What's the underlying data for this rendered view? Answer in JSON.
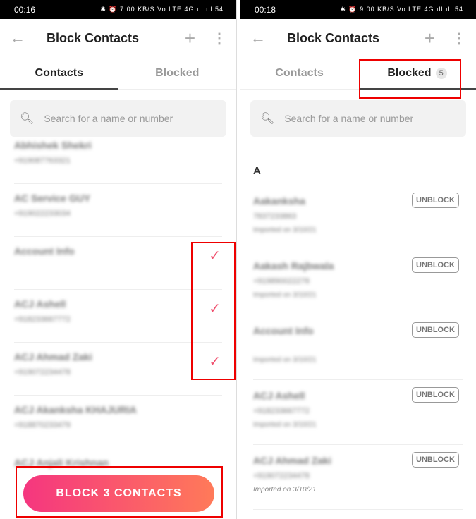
{
  "left": {
    "status": {
      "time": "00:16",
      "icons": "✱ ⏰ 7.00 KB/S Vo LTE 4G ıll ıll 54"
    },
    "title": "Block Contacts",
    "tabs": [
      "Contacts",
      "Blocked"
    ],
    "search_placeholder": "Search for a name or number",
    "contacts": [
      {
        "name": "Abhishek Shekri",
        "phone": "+919087763321",
        "checked": false
      },
      {
        "name": "AC Service GUY",
        "phone": "+919022233034",
        "checked": false
      },
      {
        "name": "Account Info",
        "phone": "",
        "checked": true
      },
      {
        "name": "ACJ Ashell",
        "phone": "+918233667772",
        "checked": true
      },
      {
        "name": "ACJ Ahmad Zaki",
        "phone": "+919072234478",
        "checked": true
      },
      {
        "name": "ACJ Akanksha KHAJURIA",
        "phone": "+918870233479",
        "checked": false
      },
      {
        "name": "ACJ Anjali Krishnan",
        "phone": "",
        "checked": false
      }
    ],
    "block_button": "BLOCK 3 CONTACTS"
  },
  "right": {
    "status": {
      "time": "00:18",
      "icons": "✱ ⏰ 9.00 KB/S Vo LTE 4G ıll ıll 54"
    },
    "title": "Block Contacts",
    "tabs": [
      "Contacts",
      "Blocked"
    ],
    "blocked_count": "5",
    "search_placeholder": "Search for a name or number",
    "section": "A",
    "unblock_label": "UNBLOCK",
    "blocked": [
      {
        "name": "Aakanksha",
        "phone": "7837233863",
        "imported": "Imported on 3/10/21"
      },
      {
        "name": "Aakash Rajbwala",
        "phone": "+919890022278",
        "imported": "Imported on 3/10/21"
      },
      {
        "name": "Account Info",
        "phone": "",
        "imported": "Imported on 3/10/21"
      },
      {
        "name": "ACJ Ashell",
        "phone": "+918233667772",
        "imported": "Imported on 3/10/21"
      },
      {
        "name": "ACJ Ahmad Zaki",
        "phone": "+919072234478",
        "imported": "Imported on 3/10/21"
      }
    ]
  },
  "colors": {
    "accent": "#f0506e",
    "gradient_start": "#f5367f",
    "gradient_end": "#ff7a59",
    "highlight": "#e00000"
  }
}
